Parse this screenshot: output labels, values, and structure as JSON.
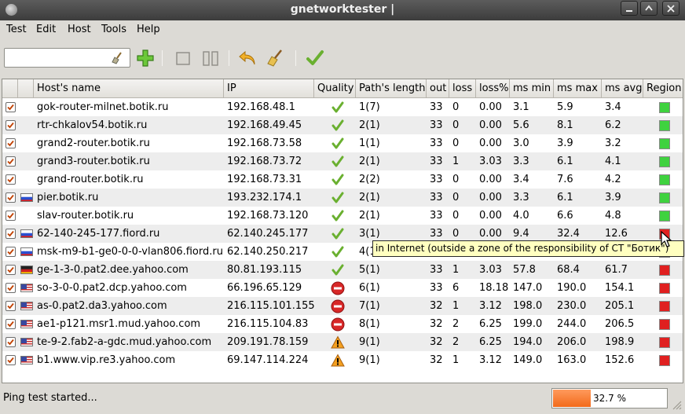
{
  "window": {
    "title": "gnetworktester |"
  },
  "menu": [
    "Test",
    "Edit",
    "Host",
    "Tools",
    "Help"
  ],
  "toolbar": {
    "host_input_value": "",
    "icons": [
      "add-icon",
      "stop-icon",
      "pause-icon",
      "undo-icon",
      "clear-icon",
      "check-icon"
    ]
  },
  "table": {
    "columns": [
      "Host's name",
      "IP",
      "Quality",
      "Path's length",
      "out",
      "loss",
      "loss%",
      "ms min",
      "ms max",
      "ms avg",
      "Region"
    ],
    "rows": [
      {
        "checked": true,
        "flag": "",
        "name": "gok-router-milnet.botik.ru",
        "ip": "192.168.48.1",
        "quality": "good",
        "path": "1(7)",
        "out": "33",
        "loss": "0",
        "loss_pct": "0.00",
        "min": "3.1",
        "max": "5.9",
        "avg": "3.4",
        "region": "green"
      },
      {
        "checked": true,
        "flag": "",
        "name": "rtr-chkalov54.botik.ru",
        "ip": "192.168.49.45",
        "quality": "good",
        "path": "2(1)",
        "out": "33",
        "loss": "0",
        "loss_pct": "0.00",
        "min": "5.6",
        "max": "8.1",
        "avg": "6.2",
        "region": "green"
      },
      {
        "checked": true,
        "flag": "",
        "name": "grand2-router.botik.ru",
        "ip": "192.168.73.58",
        "quality": "good",
        "path": "1(1)",
        "out": "33",
        "loss": "0",
        "loss_pct": "0.00",
        "min": "3.0",
        "max": "3.9",
        "avg": "3.2",
        "region": "green"
      },
      {
        "checked": true,
        "flag": "",
        "name": "grand3-router.botik.ru",
        "ip": "192.168.73.72",
        "quality": "good",
        "path": "2(1)",
        "out": "33",
        "loss": "1",
        "loss_pct": "3.03",
        "min": "3.3",
        "max": "6.1",
        "avg": "4.1",
        "region": "green"
      },
      {
        "checked": true,
        "flag": "",
        "name": "grand-router.botik.ru",
        "ip": "192.168.73.31",
        "quality": "good",
        "path": "2(2)",
        "out": "33",
        "loss": "0",
        "loss_pct": "0.00",
        "min": "3.4",
        "max": "7.6",
        "avg": "4.2",
        "region": "green"
      },
      {
        "checked": true,
        "flag": "ru",
        "name": "pier.botik.ru",
        "ip": "193.232.174.1",
        "quality": "good",
        "path": "2(1)",
        "out": "33",
        "loss": "0",
        "loss_pct": "0.00",
        "min": "3.3",
        "max": "6.1",
        "avg": "3.9",
        "region": "green"
      },
      {
        "checked": true,
        "flag": "",
        "name": "slav-router.botik.ru",
        "ip": "192.168.73.120",
        "quality": "good",
        "path": "2(1)",
        "out": "33",
        "loss": "0",
        "loss_pct": "0.00",
        "min": "4.0",
        "max": "6.6",
        "avg": "4.8",
        "region": "green"
      },
      {
        "checked": true,
        "flag": "ru",
        "name": "62-140-245-177.fiord.ru",
        "ip": "62.140.245.177",
        "quality": "good",
        "path": "3(1)",
        "out": "33",
        "loss": "0",
        "loss_pct": "0.00",
        "min": "9.4",
        "max": "32.4",
        "avg": "12.6",
        "region": "red"
      },
      {
        "checked": true,
        "flag": "ru",
        "name": "msk-m9-b1-ge0-0-0-vlan806.fiord.ru",
        "ip": "62.140.250.217",
        "quality": "good",
        "path": "4(1)",
        "out": "",
        "loss": "",
        "loss_pct": "",
        "min": "",
        "max": "",
        "avg": "",
        "region": "red"
      },
      {
        "checked": true,
        "flag": "de",
        "name": "ge-1-3-0.pat2.dee.yahoo.com",
        "ip": "80.81.193.115",
        "quality": "good",
        "path": "5(1)",
        "out": "33",
        "loss": "1",
        "loss_pct": "3.03",
        "min": "57.8",
        "max": "68.4",
        "avg": "61.7",
        "region": "red"
      },
      {
        "checked": true,
        "flag": "us",
        "name": "so-3-0-0.pat2.dcp.yahoo.com",
        "ip": "66.196.65.129",
        "quality": "bad",
        "path": "6(1)",
        "out": "33",
        "loss": "6",
        "loss_pct": "18.18",
        "min": "147.0",
        "max": "190.0",
        "avg": "154.1",
        "region": "red"
      },
      {
        "checked": true,
        "flag": "us",
        "name": "as-0.pat2.da3.yahoo.com",
        "ip": "216.115.101.155",
        "quality": "bad",
        "path": "7(1)",
        "out": "32",
        "loss": "1",
        "loss_pct": "3.12",
        "min": "198.0",
        "max": "230.0",
        "avg": "205.1",
        "region": "red"
      },
      {
        "checked": true,
        "flag": "us",
        "name": "ae1-p121.msr1.mud.yahoo.com",
        "ip": "216.115.104.83",
        "quality": "bad",
        "path": "8(1)",
        "out": "32",
        "loss": "2",
        "loss_pct": "6.25",
        "min": "199.0",
        "max": "244.0",
        "avg": "206.5",
        "region": "red"
      },
      {
        "checked": true,
        "flag": "us",
        "name": "te-9-2.fab2-a-gdc.mud.yahoo.com",
        "ip": "209.191.78.159",
        "quality": "warn",
        "path": "9(1)",
        "out": "32",
        "loss": "2",
        "loss_pct": "6.25",
        "min": "194.0",
        "max": "206.0",
        "avg": "198.9",
        "region": "red"
      },
      {
        "checked": true,
        "flag": "us",
        "name": "b1.www.vip.re3.yahoo.com",
        "ip": "69.147.114.224",
        "quality": "warn",
        "path": "9(1)",
        "out": "32",
        "loss": "1",
        "loss_pct": "3.12",
        "min": "149.0",
        "max": "163.0",
        "avg": "152.6",
        "region": "red"
      }
    ]
  },
  "tooltip": "in Internet (outside a zone of the responsibility of CT \"Ботик\")",
  "status": {
    "text": "Ping test started...",
    "progress_label": "32.7 %",
    "progress_fraction": 0.327
  },
  "colors": {
    "green": "#3fd23f",
    "red": "#e02020",
    "progress": "#f26a1b"
  }
}
